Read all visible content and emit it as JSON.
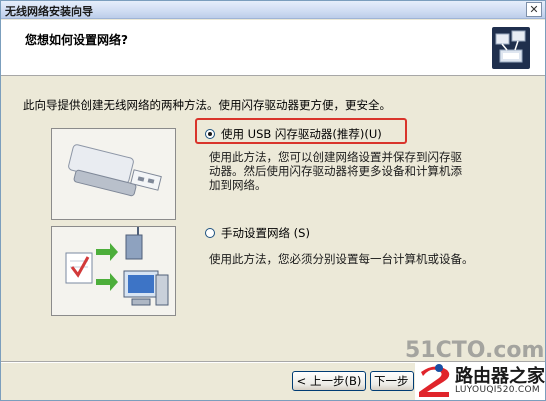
{
  "window": {
    "title": "无线网络安装向导",
    "close_glyph": "✕"
  },
  "header": {
    "heading": "您想如何设置网络?"
  },
  "intro": "此向导提供创建无线网络的两种方法。使用闪存驱动器更方便，更安全。",
  "options": [
    {
      "label": "使用 USB 闪存驱动器(推荐)(U)",
      "selected": true,
      "description": [
        "使用此方法，您可以创建网络设置并保存到闪存驱",
        "动器。然后使用闪存驱动器将更多设备和计算机添",
        "加到网络。"
      ]
    },
    {
      "label": "手动设置网络 (S)",
      "selected": false,
      "description": [
        "使用此方法，您必须分别设置每一台计算机或设备。"
      ]
    }
  ],
  "buttons": {
    "back": "< 上一步(B)",
    "next": "下一步"
  },
  "watermark": {
    "site1": "51CTO.com",
    "site2": "路由器之家",
    "url": "LUYOUQI520.COM"
  },
  "icons": {
    "wizard": "network-wizard-icon",
    "usb": "usb-flash-drive-icon",
    "network": "network-devices-icon"
  },
  "colors": {
    "highlight_border": "#d9342b",
    "dialog_bg": "#ece9d8"
  }
}
